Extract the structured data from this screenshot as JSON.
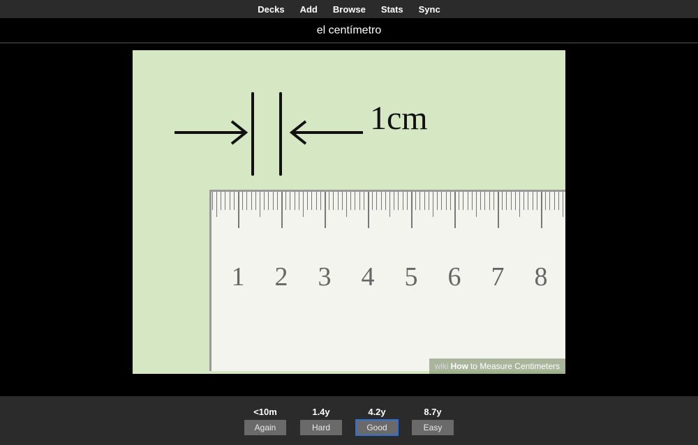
{
  "nav": {
    "decks": "Decks",
    "add": "Add",
    "browse": "Browse",
    "stats": "Stats",
    "sync": "Sync"
  },
  "card": {
    "front": "el centímetro",
    "illustration_label": "1cm",
    "ruler_numbers": [
      "1",
      "2",
      "3",
      "4",
      "5",
      "6",
      "7",
      "8"
    ],
    "caption_wiki": "wiki",
    "caption_how": "How",
    "caption_rest": " to Measure Centimeters"
  },
  "answer_buttons": [
    {
      "interval": "<10m",
      "label": "Again",
      "selected": false
    },
    {
      "interval": "1.4y",
      "label": "Hard",
      "selected": false
    },
    {
      "interval": "4.2y",
      "label": "Good",
      "selected": true
    },
    {
      "interval": "8.7y",
      "label": "Easy",
      "selected": false
    }
  ]
}
